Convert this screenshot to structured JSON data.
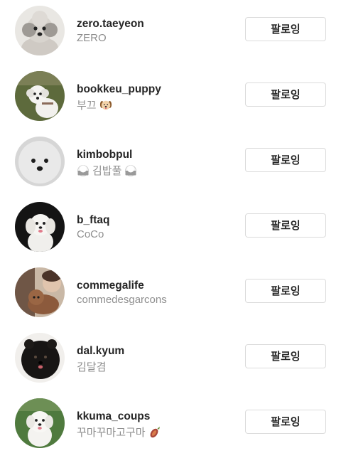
{
  "following_list": [
    {
      "username": "zero.taeyeon",
      "subtitle": "ZERO",
      "button_label": "팔로잉",
      "avatar_icon": "profile-photo-gray-poodle"
    },
    {
      "username": "bookkeu_puppy",
      "subtitle": "부끄",
      "subtitle_emoji_after": "dog-face-emoji",
      "button_label": "팔로잉",
      "avatar_icon": "profile-photo-white-dog-on-grass"
    },
    {
      "username": "kimbobpul",
      "subtitle": "김밥풀",
      "subtitle_emoji_before": "rice-ball-emoji",
      "subtitle_emoji_after": "rice-ball-emoji",
      "button_label": "팔로잉",
      "avatar_icon": "profile-photo-white-bichon-closeup"
    },
    {
      "username": "b_ftaq",
      "subtitle": "CoCo",
      "button_label": "팔로잉",
      "avatar_icon": "profile-photo-white-maltese-dark-bg"
    },
    {
      "username": "commegalife",
      "subtitle": "commedesgarcons",
      "button_label": "팔로잉",
      "avatar_icon": "profile-photo-brown-poodle-with-person"
    },
    {
      "username": "dal.kyum",
      "subtitle": "김달겸",
      "button_label": "팔로잉",
      "avatar_icon": "profile-photo-black-pomeranian"
    },
    {
      "username": "kkuma_coups",
      "subtitle": "꾸마꾸마고구마",
      "subtitle_emoji_after": "sweet-potato-emoji",
      "button_label": "팔로잉",
      "avatar_icon": "profile-photo-white-dog-on-grass-2"
    }
  ]
}
